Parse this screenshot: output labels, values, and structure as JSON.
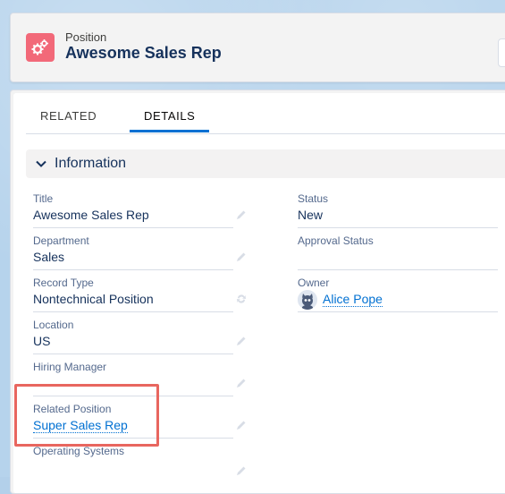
{
  "header": {
    "object_label": "Position",
    "record_title": "Awesome Sales Rep",
    "icon": "gears-icon",
    "icon_color": "#f26979"
  },
  "tabs": [
    {
      "label": "RELATED",
      "active": false
    },
    {
      "label": "DETAILS",
      "active": true
    }
  ],
  "section": {
    "title": "Information",
    "icon": "chevron-down-icon"
  },
  "left_fields": [
    {
      "label": "Title",
      "value": "Awesome Sales Rep"
    },
    {
      "label": "Department",
      "value": "Sales"
    },
    {
      "label": "Record Type",
      "value": "Nontechnical Position"
    },
    {
      "label": "Location",
      "value": "US"
    },
    {
      "label": "Hiring Manager",
      "value": ""
    },
    {
      "label": "Related Position",
      "value": "Super Sales Rep"
    },
    {
      "label": "Operating Systems",
      "value": ""
    }
  ],
  "right_fields": [
    {
      "label": "Status",
      "value": "New"
    },
    {
      "label": "Approval Status",
      "value": ""
    },
    {
      "label": "Owner",
      "value": "Alice Pope"
    }
  ],
  "colors": {
    "accent": "#0070d2",
    "highlight": "#e8665f"
  }
}
